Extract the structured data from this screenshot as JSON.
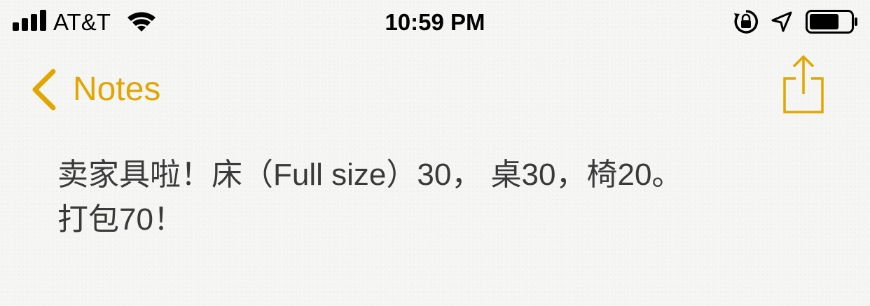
{
  "status_bar": {
    "carrier": "AT&T",
    "time": "10:59 PM",
    "signal_bars_filled": 4,
    "battery_level": 0.72,
    "icons": [
      "signal-icon",
      "wifi-icon",
      "rotation-lock-icon",
      "location-icon",
      "battery-icon"
    ]
  },
  "nav": {
    "back_label": "Notes",
    "back_icon": "chevron-left-icon",
    "share_icon": "share-icon",
    "accent_color": "#e2a600"
  },
  "note": {
    "lines": [
      "卖家具啦！床（Full size）30， 桌30，椅20。",
      "打包70！"
    ]
  }
}
